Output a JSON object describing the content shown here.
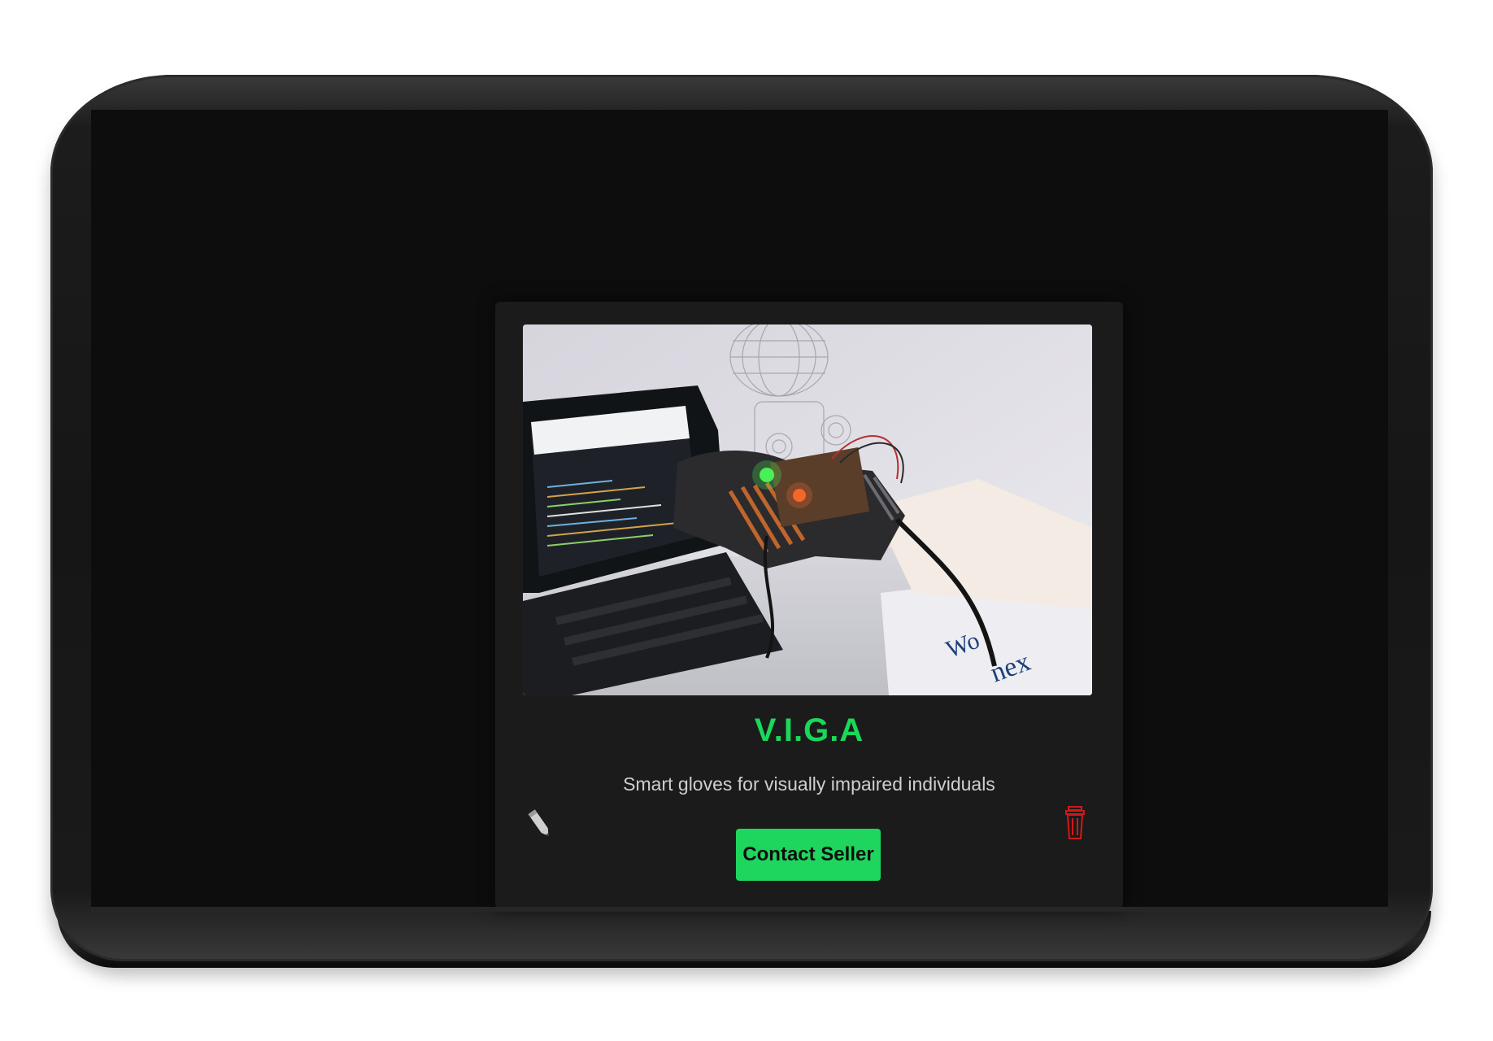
{
  "product": {
    "title": "V.I.G.A",
    "description": "Smart gloves for visually impaired individuals",
    "image_alt": "Photo of smart glove prototype worn on a hand near a laptop",
    "contact_button_label": "Contact Seller"
  },
  "icons": {
    "edit": "pencil-icon",
    "delete": "trash-icon"
  },
  "colors": {
    "accent": "#19d85a",
    "button_bg": "#1ed65d",
    "delete": "#d01818",
    "card_bg": "#1b1b1b",
    "screen_bg": "#0d0d0d"
  }
}
